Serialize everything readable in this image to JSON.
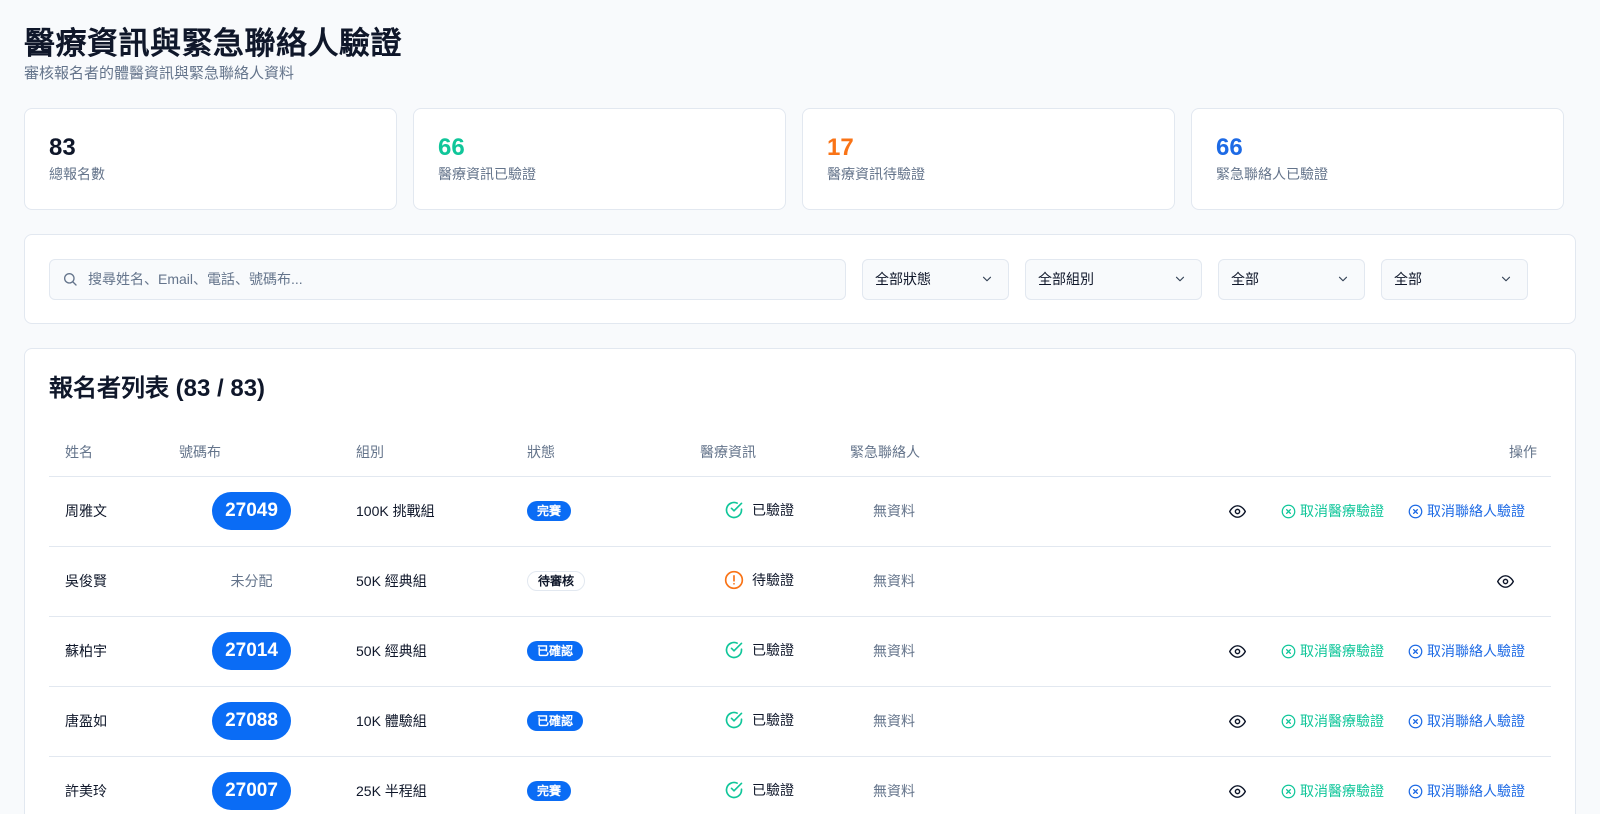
{
  "header": {
    "title": "醫療資訊與緊急聯絡人驗證",
    "subtitle": "審核報名者的體醫資訊與緊急聯絡人資料"
  },
  "stats": [
    {
      "value": "83",
      "label": "總報名數",
      "color": "#0f172a"
    },
    {
      "value": "66",
      "label": "醫療資訊已驗證",
      "color": "#10c69a"
    },
    {
      "value": "17",
      "label": "醫療資訊待驗證",
      "color": "#f97316"
    },
    {
      "value": "66",
      "label": "緊急聯絡人已驗證",
      "color": "#1d6ae5"
    }
  ],
  "filters": {
    "search_placeholder": "搜尋姓名、Email、電話、號碼布...",
    "status": "全部狀態",
    "group": "全部組別",
    "medical": "全部",
    "emergency": "全部"
  },
  "list": {
    "title": "報名者列表 (83 / 83)",
    "columns": {
      "name": "姓名",
      "bib": "號碼布",
      "group": "組別",
      "status": "狀態",
      "medical": "醫療資訊",
      "emergency": "緊急聯絡人",
      "actions": "操作"
    },
    "rows": [
      {
        "name": "周雅文",
        "bib": "27049",
        "group": "100K 挑戰組",
        "status": "完賽",
        "medical": "已驗證",
        "emergency": "無資料"
      },
      {
        "name": "吳俊賢",
        "bib": "未分配",
        "group": "50K 經典組",
        "status": "待審核",
        "medical": "待驗證",
        "emergency": "無資料"
      },
      {
        "name": "蘇柏宇",
        "bib": "27014",
        "group": "50K 經典組",
        "status": "已確認",
        "medical": "已驗證",
        "emergency": "無資料"
      },
      {
        "name": "唐盈如",
        "bib": "27088",
        "group": "10K 體驗組",
        "status": "已確認",
        "medical": "已驗證",
        "emergency": "無資料"
      },
      {
        "name": "許美玲",
        "bib": "27007",
        "group": "25K 半程組",
        "status": "完賽",
        "medical": "已驗證",
        "emergency": "無資料"
      }
    ],
    "action_labels": {
      "cancel_medical": "取消醫療驗證",
      "cancel_emergency": "取消聯絡人驗證"
    }
  },
  "colors": {
    "accent_blue": "#0a6cf5",
    "verified_green": "#10c69a",
    "pending_orange": "#f97316",
    "muted": "#64748b"
  }
}
